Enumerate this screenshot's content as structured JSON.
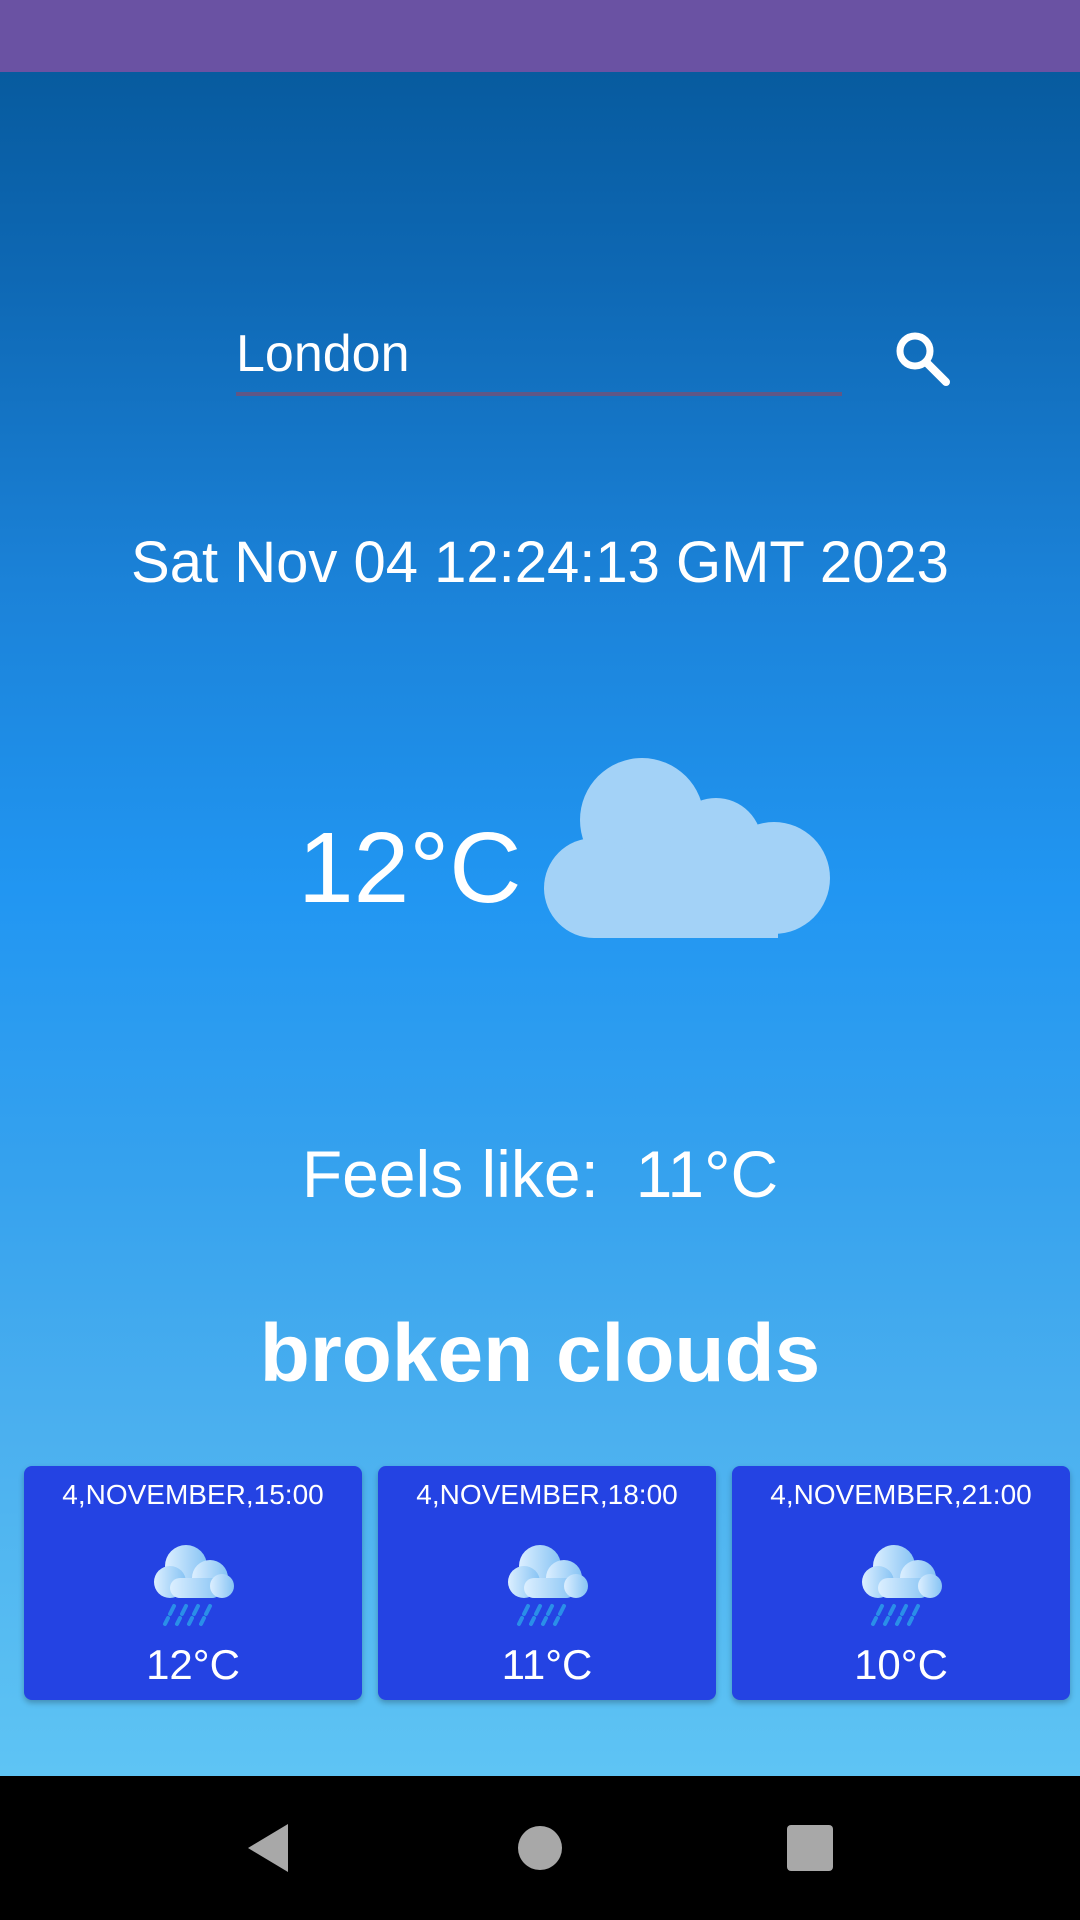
{
  "search": {
    "value": "London",
    "icon": "search-icon"
  },
  "current": {
    "datetime": "Sat Nov 04 12:24:13 GMT 2023",
    "temperature": "12°C",
    "icon": "cloud-icon",
    "feels_like_label": "Feels like:",
    "feels_like_value": "11°C",
    "condition": "broken clouds"
  },
  "forecast": [
    {
      "time": "4,NOVEMBER,15:00",
      "icon": "rain-cloud-icon",
      "temperature": "12°C"
    },
    {
      "time": "4,NOVEMBER,18:00",
      "icon": "rain-cloud-icon",
      "temperature": "11°C"
    },
    {
      "time": "4,NOVEMBER,21:00",
      "icon": "rain-cloud-icon",
      "temperature": "10°C"
    }
  ],
  "navigation": {
    "back_icon": "back-triangle-icon",
    "home_icon": "home-circle-icon",
    "recents_icon": "recents-square-icon"
  },
  "colors": {
    "status_bar": "#6a52a3",
    "card": "#2443e3",
    "cloud": "#a3d2f7",
    "rain": "#2a8fe8"
  }
}
